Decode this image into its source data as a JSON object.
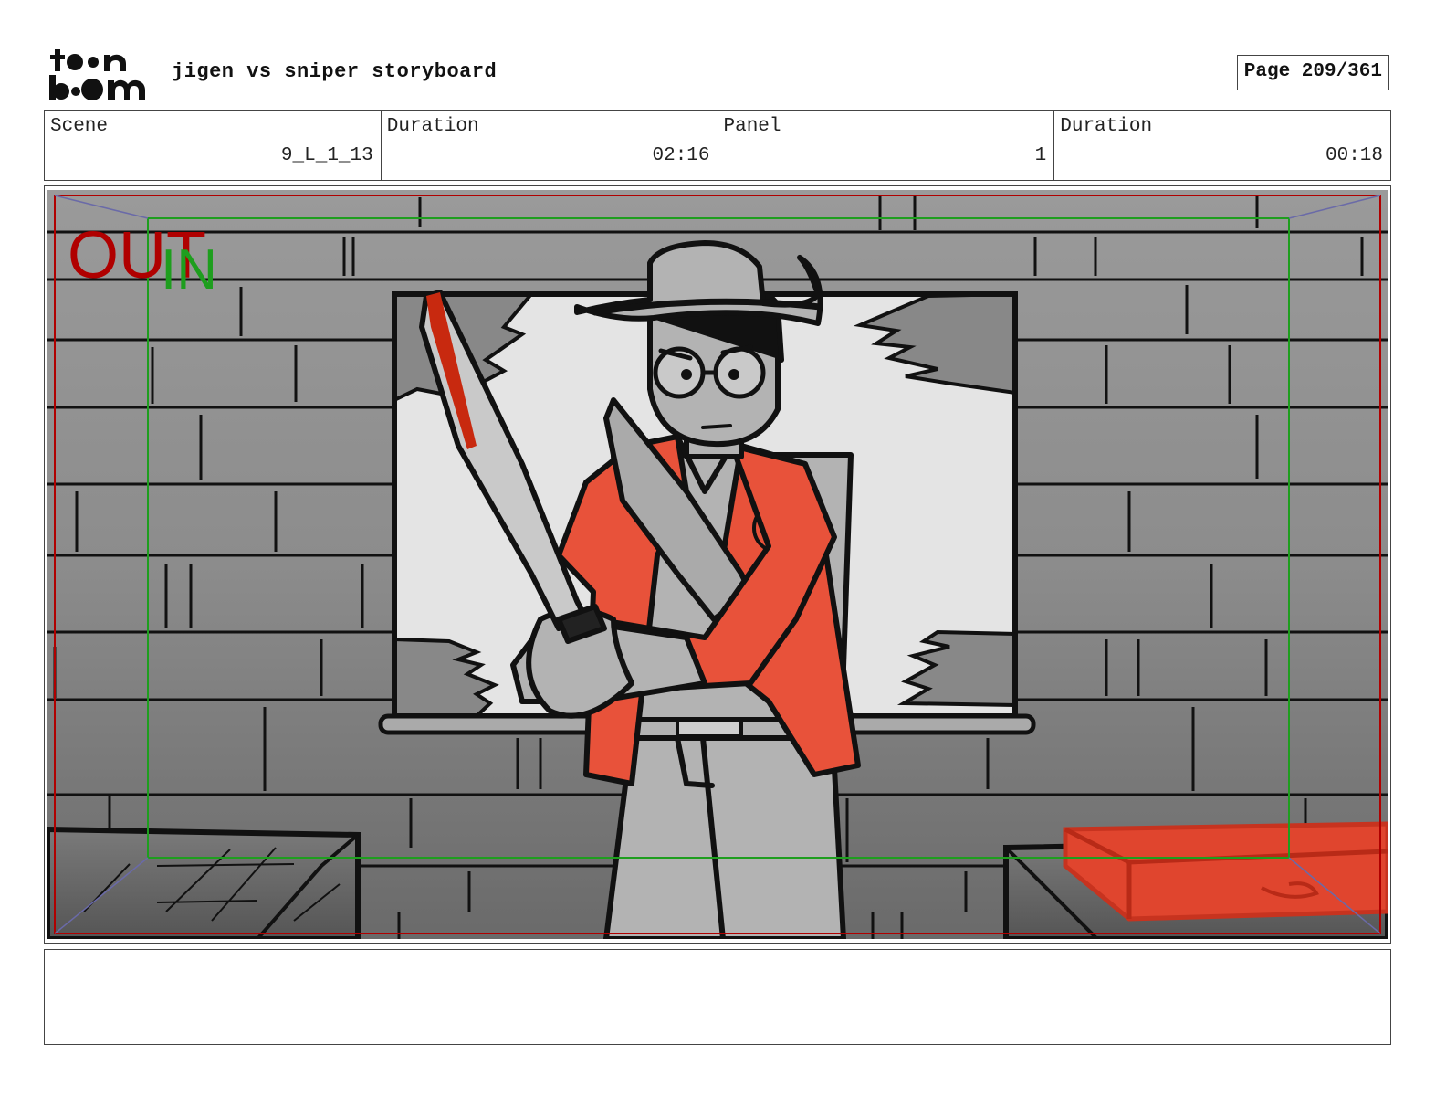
{
  "header": {
    "logo_text": "toon boom",
    "title": "jigen vs sniper storyboard",
    "page_label": "Page 209/361"
  },
  "info": [
    {
      "label": "Scene",
      "value": "9_L_1_13"
    },
    {
      "label": "Duration",
      "value": "02:16"
    },
    {
      "label": "Panel",
      "value": "1"
    },
    {
      "label": "Duration",
      "value": "00:18"
    }
  ],
  "panel": {
    "frame_out_label": "OUT",
    "frame_in_label": "IN",
    "colors": {
      "out_frame": "#b00000",
      "in_frame": "#1e9e1e",
      "jacket": "#e8523a",
      "wall": "#8a8a8a",
      "window": "#e4e4e4"
    }
  },
  "notes": {
    "text": ""
  }
}
